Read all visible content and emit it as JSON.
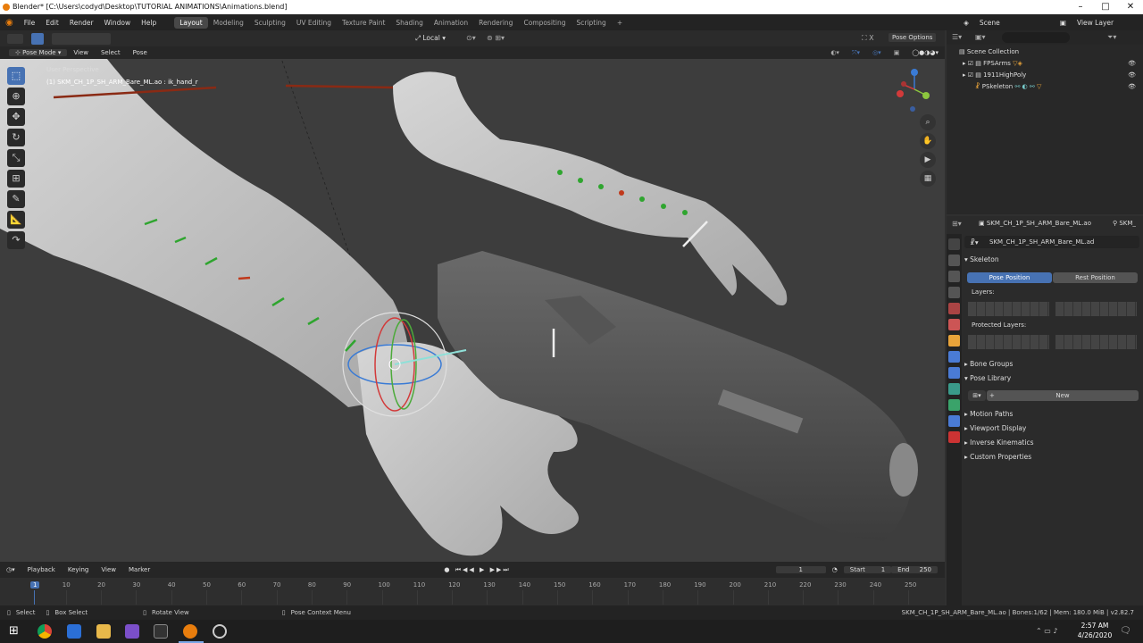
{
  "window": {
    "title": "Blender* [C:\\Users\\codyd\\Desktop\\TUTORIAL ANIMATIONS\\Animations.blend]"
  },
  "menu": [
    "File",
    "Edit",
    "Render",
    "Window",
    "Help"
  ],
  "workspaces": [
    "Layout",
    "Modeling",
    "Sculpting",
    "UV Editing",
    "Texture Paint",
    "Shading",
    "Animation",
    "Rendering",
    "Compositing",
    "Scripting"
  ],
  "scene": {
    "label": "Scene",
    "view_layer": "View Layer"
  },
  "viewport": {
    "mode": "Pose Mode",
    "menus": [
      "View",
      "Select",
      "Pose"
    ],
    "orientation": "Local",
    "pose_options": "Pose Options",
    "perspective": "User Perspective",
    "active": "(1) SKM_CH_1P_SH_ARM_Bare_ML.ao : ik_hand_r"
  },
  "outliner": {
    "root": "Scene Collection",
    "items": [
      "FPSArms",
      "1911HighPoly",
      "PSkeleton"
    ]
  },
  "properties": {
    "object": "SKM_CH_1P_SH_ARM_Bare_ML.ao",
    "tab_short": "SKM_",
    "data_name": "SKM_CH_1P_SH_ARM_Bare_ML.ad",
    "skeleton": "Skeleton",
    "pose_position": "Pose Position",
    "rest_position": "Rest Position",
    "layers": "Layers:",
    "protected_layers": "Protected Layers:",
    "bone_groups": "Bone Groups",
    "pose_library": "Pose Library",
    "new": "New",
    "sections": [
      "Motion Paths",
      "Viewport Display",
      "Inverse Kinematics",
      "Custom Properties"
    ]
  },
  "timeline": {
    "menus": [
      "Playback",
      "Keying",
      "View",
      "Marker"
    ],
    "current": "1",
    "start_label": "Start",
    "start": "1",
    "end_label": "End",
    "end": "250",
    "ticks": [
      "1",
      "10",
      "20",
      "30",
      "40",
      "50",
      "60",
      "70",
      "80",
      "90",
      "100",
      "110",
      "120",
      "130",
      "140",
      "150",
      "160",
      "170",
      "180",
      "190",
      "200",
      "210",
      "220",
      "230",
      "240",
      "250"
    ]
  },
  "status": {
    "select": "Select",
    "box_select": "Box Select",
    "rotate": "Rotate View",
    "context": "Pose Context Menu",
    "info": "SKM_CH_1P_SH_ARM_Bare_ML.ao | Bones:1/62 | Mem: 180.0 MiB | v2.82.7"
  },
  "taskbar": {
    "time": "2:57 AM",
    "date": "4/26/2020"
  },
  "colors": {
    "accent": "#4772b3",
    "bone_green": "#2fa52f",
    "bone_red": "#c0391b",
    "orange": "#e87d0d"
  }
}
